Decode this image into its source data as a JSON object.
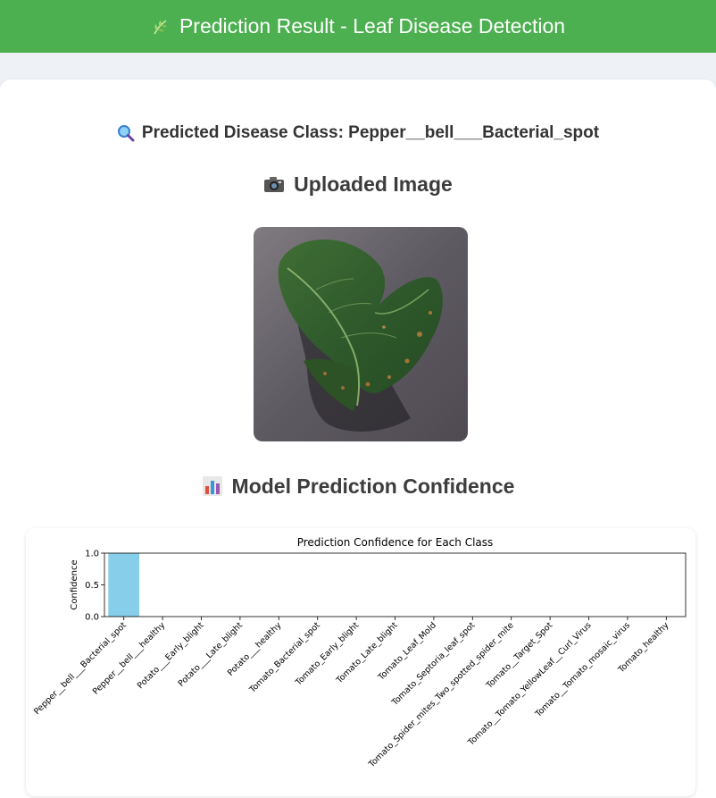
{
  "header": {
    "title": "Prediction Result - Leaf Disease Detection",
    "icon": "leaf-icon",
    "background": "#4caf50"
  },
  "prediction": {
    "label": "Predicted Disease Class: Pepper__bell___Bacterial_spot",
    "icon": "magnifier-icon"
  },
  "uploaded": {
    "heading": "Uploaded Image",
    "icon": "camera-icon"
  },
  "confidence": {
    "heading": "Model Prediction Confidence",
    "icon": "bar-chart-icon"
  },
  "chart_data": {
    "type": "bar",
    "title": "Prediction Confidence for Each Class",
    "xlabel": "",
    "ylabel": "Confidence",
    "ylim": [
      0,
      1.0
    ],
    "yticks": [
      "0.0",
      "0.5",
      "1.0"
    ],
    "bar_color": "#87ceeb",
    "grid": false,
    "categories": [
      "Pepper__bell___Bacterial_spot",
      "Pepper__bell___healthy",
      "Potato___Early_blight",
      "Potato___Late_blight",
      "Potato___healthy",
      "Tomato_Bacterial_spot",
      "Tomato_Early_blight",
      "Tomato_Late_blight",
      "Tomato_Leaf_Mold",
      "Tomato_Septoria_leaf_spot",
      "Tomato_Spider_mites_Two_spotted_spider_mite",
      "Tomato__Target_Spot",
      "Tomato__Tomato_YellowLeaf__Curl_Virus",
      "Tomato__Tomato_mosaic_virus",
      "Tomato_healthy"
    ],
    "values": [
      1.0,
      0,
      0,
      0,
      0,
      0,
      0,
      0,
      0,
      0,
      0,
      0,
      0,
      0,
      0
    ]
  }
}
